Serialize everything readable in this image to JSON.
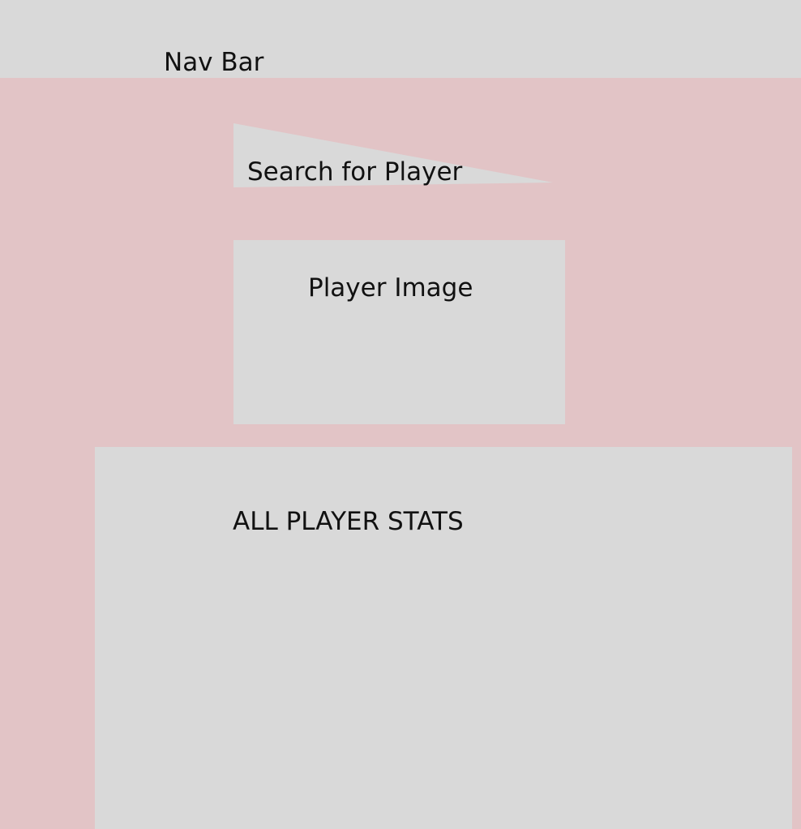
{
  "navbar": {
    "label": "Nav Bar"
  },
  "search": {
    "placeholder": "Search for Player"
  },
  "player_image": {
    "label": "Player Image"
  },
  "stats": {
    "label": "ALL PLAYER STATS"
  },
  "colors": {
    "page_background": "#E2C4C6",
    "block_fill": "#D9D9D9",
    "text": "#111111"
  }
}
